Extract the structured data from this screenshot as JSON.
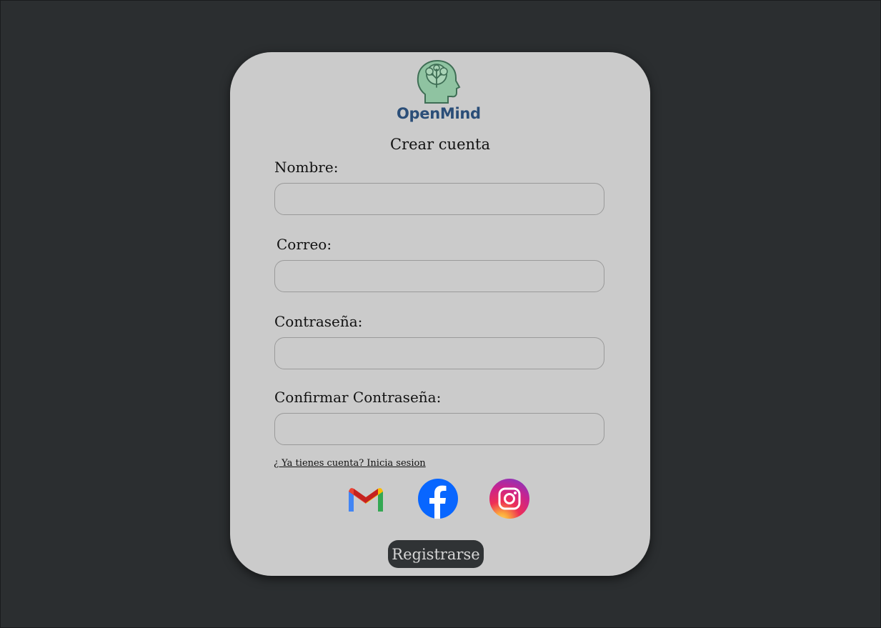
{
  "logo": {
    "text": "OpenMind",
    "icon": "brain-head-icon"
  },
  "form": {
    "title": "Crear cuenta",
    "fields": [
      {
        "label": "Nombre:",
        "value": "",
        "placeholder": ""
      },
      {
        "label": "Correo:",
        "value": "",
        "placeholder": ""
      },
      {
        "label": "Contraseña:",
        "value": "",
        "placeholder": ""
      },
      {
        "label": "Confirmar Contraseña:",
        "value": "",
        "placeholder": ""
      }
    ],
    "login_link": "¿ Ya tienes cuenta? Inicia sesion",
    "social": [
      "gmail-icon",
      "facebook-icon",
      "instagram-icon"
    ],
    "submit_label": "Registrarse"
  },
  "colors": {
    "background": "#2b2e30",
    "card": "#cbcbcb",
    "button": "#303335",
    "logo_text": "#2b4e78",
    "logo_head": "#8fc3a1"
  }
}
